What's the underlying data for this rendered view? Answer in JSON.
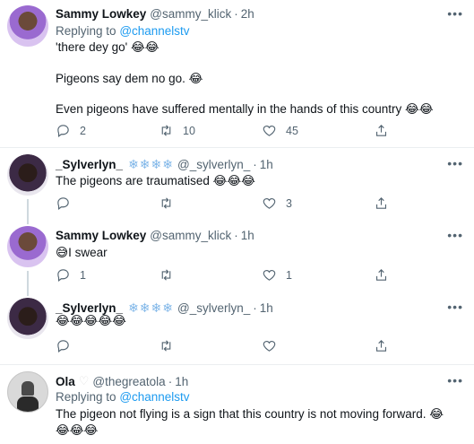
{
  "tweets": [
    {
      "name": "Sammy Lowkey",
      "handle": "@sammy_klick",
      "time": "2h",
      "replying_prefix": "Replying to",
      "replying_to": "@channelstv",
      "lines": [
        "'there dey go' 😂😂",
        "Pigeons say dem no go. 😂",
        "Even pigeons have suffered mentally in the hands of this country 😂😂"
      ],
      "replies": "2",
      "retweets": "10",
      "likes": "45"
    },
    {
      "name": "_Sylverlyn_",
      "deco": "❄❄❄❄",
      "handle": "@_sylverlyn_",
      "time": "1h",
      "lines": [
        "The pigeons are traumatised 😂😂😂"
      ],
      "replies": "",
      "retweets": "",
      "likes": "3"
    },
    {
      "name": "Sammy Lowkey",
      "handle": "@sammy_klick",
      "time": "1h",
      "lines": [
        "😅I swear"
      ],
      "replies": "1",
      "retweets": "",
      "likes": "1"
    },
    {
      "name": "_Sylverlyn_",
      "deco": "❄❄❄❄",
      "handle": "@_sylverlyn_",
      "time": "1h",
      "lines": [
        "😂😂😂😂😂"
      ],
      "replies": "",
      "retweets": "",
      "likes": ""
    },
    {
      "name": "Ola",
      "deco": "♡",
      "handle": "@thegreatola",
      "time": "1h",
      "replying_prefix": "Replying to",
      "replying_to": "@channelstv",
      "lines": [
        "The pigeon not flying is a sign that this country is not moving forward. 😂",
        "😂😂😂"
      ]
    }
  ],
  "ui": {
    "dot": "·",
    "more": "•••"
  }
}
